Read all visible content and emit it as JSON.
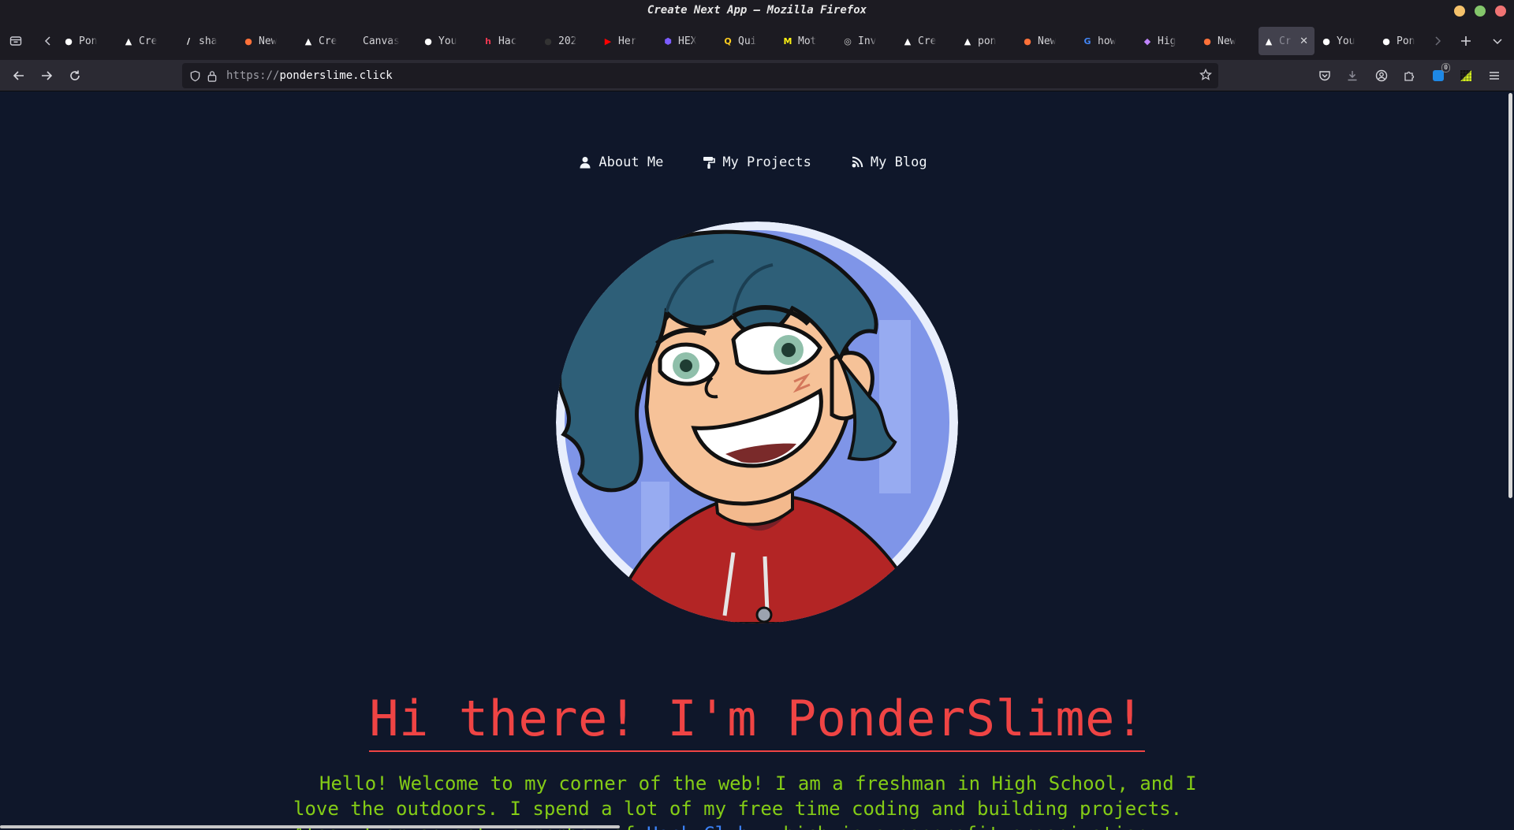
{
  "window": {
    "title": "Create Next App — Mozilla Firefox",
    "controls": {
      "colors": [
        "#f5c26b",
        "#84c66b",
        "#f07474"
      ]
    }
  },
  "tabs": [
    {
      "label": "PonderSlime",
      "icon": "github-octocat-icon",
      "color": "#ffffff"
    },
    {
      "label": "Create Next App",
      "icon": "vercel-triangle-icon",
      "color": "#ffffff"
    },
    {
      "label": "shadcn/ui",
      "icon": "shadcn-slash-icon",
      "color": "#ffffff"
    },
    {
      "label": "New Tab",
      "icon": "firefox-icon",
      "color": "#ff7139"
    },
    {
      "label": "Create Next App",
      "icon": "vercel-triangle-icon",
      "color": "#ffffff"
    },
    {
      "label": "Canvas",
      "icon": "",
      "color": ""
    },
    {
      "label": "Your Repositories",
      "icon": "github-octocat-icon",
      "color": "#ffffff"
    },
    {
      "label": "Hack Club",
      "icon": "hackclub-h-icon",
      "color": "#ec3750"
    },
    {
      "label": "2024",
      "icon": "dark-circle-icon",
      "color": "#333333"
    },
    {
      "label": "Hero",
      "icon": "youtube-icon",
      "color": "#ff0000"
    },
    {
      "label": "HEX",
      "icon": "hex-icon",
      "color": "#7c5cff"
    },
    {
      "label": "Quizlet",
      "icon": "quizlet-icon",
      "color": "#ffcd1f"
    },
    {
      "label": "Motion",
      "icon": "motion-icon",
      "color": "#fff312"
    },
    {
      "label": "Invidious",
      "icon": "invidious-icon",
      "color": "#cccccc"
    },
    {
      "label": "Create Next App",
      "icon": "vercel-triangle-icon",
      "color": "#ffffff"
    },
    {
      "label": "ponderslime",
      "icon": "vercel-triangle-icon",
      "color": "#ffffff"
    },
    {
      "label": "New Tab",
      "icon": "firefox-icon",
      "color": "#ff7139"
    },
    {
      "label": "how",
      "icon": "google-icon",
      "color": "#4285f4"
    },
    {
      "label": "Highlight",
      "icon": "highlight-icon",
      "color": "#c084fc"
    },
    {
      "label": "New Tab",
      "icon": "firefox-icon",
      "color": "#ff7139"
    },
    {
      "label": "Create Next App",
      "icon": "vercel-triangle-icon",
      "color": "#ffffff",
      "active": true
    },
    {
      "label": "Your Repositories",
      "icon": "github-octocat-icon",
      "color": "#ffffff"
    },
    {
      "label": "PonderSlime",
      "icon": "github-octocat-icon",
      "color": "#ffffff"
    }
  ],
  "visible_tab_labels": [
    "Pon",
    "Cre",
    "sha",
    "New",
    "Cre",
    "Canvas",
    "You",
    "Hac",
    "202",
    "Her",
    "HEX",
    "Qui",
    "Mot",
    "Inv",
    "Cre",
    "pon",
    "New",
    "how",
    "Hig",
    "New",
    "Cr",
    "You",
    "Pon"
  ],
  "toolbar": {
    "url_protocol": "https://",
    "url_host": "ponderslime.click",
    "extension_badge": "0"
  },
  "site": {
    "nav": [
      {
        "label": "About Me",
        "icon": "user-icon"
      },
      {
        "label": "My Projects",
        "icon": "paint-roller-icon"
      },
      {
        "label": "My Blog",
        "icon": "rss-feed-icon"
      }
    ],
    "avatar_alt": "cartoon avatar",
    "heading": "Hi there! I'm PonderSlime!",
    "intro": {
      "text_1": "Hello! Welcome to my corner of the web! I am a freshman in High School, and I love the outdoors. I spend a lot of my free time coding and building projects. Also, I am an active member of ",
      "link": "Hack Club",
      "text_2": ", which is a nonprofit organization"
    },
    "colors": {
      "background": "#0f172a",
      "heading": "#ef4444",
      "body_text": "#84cc16",
      "link": "#3b82f6"
    }
  }
}
